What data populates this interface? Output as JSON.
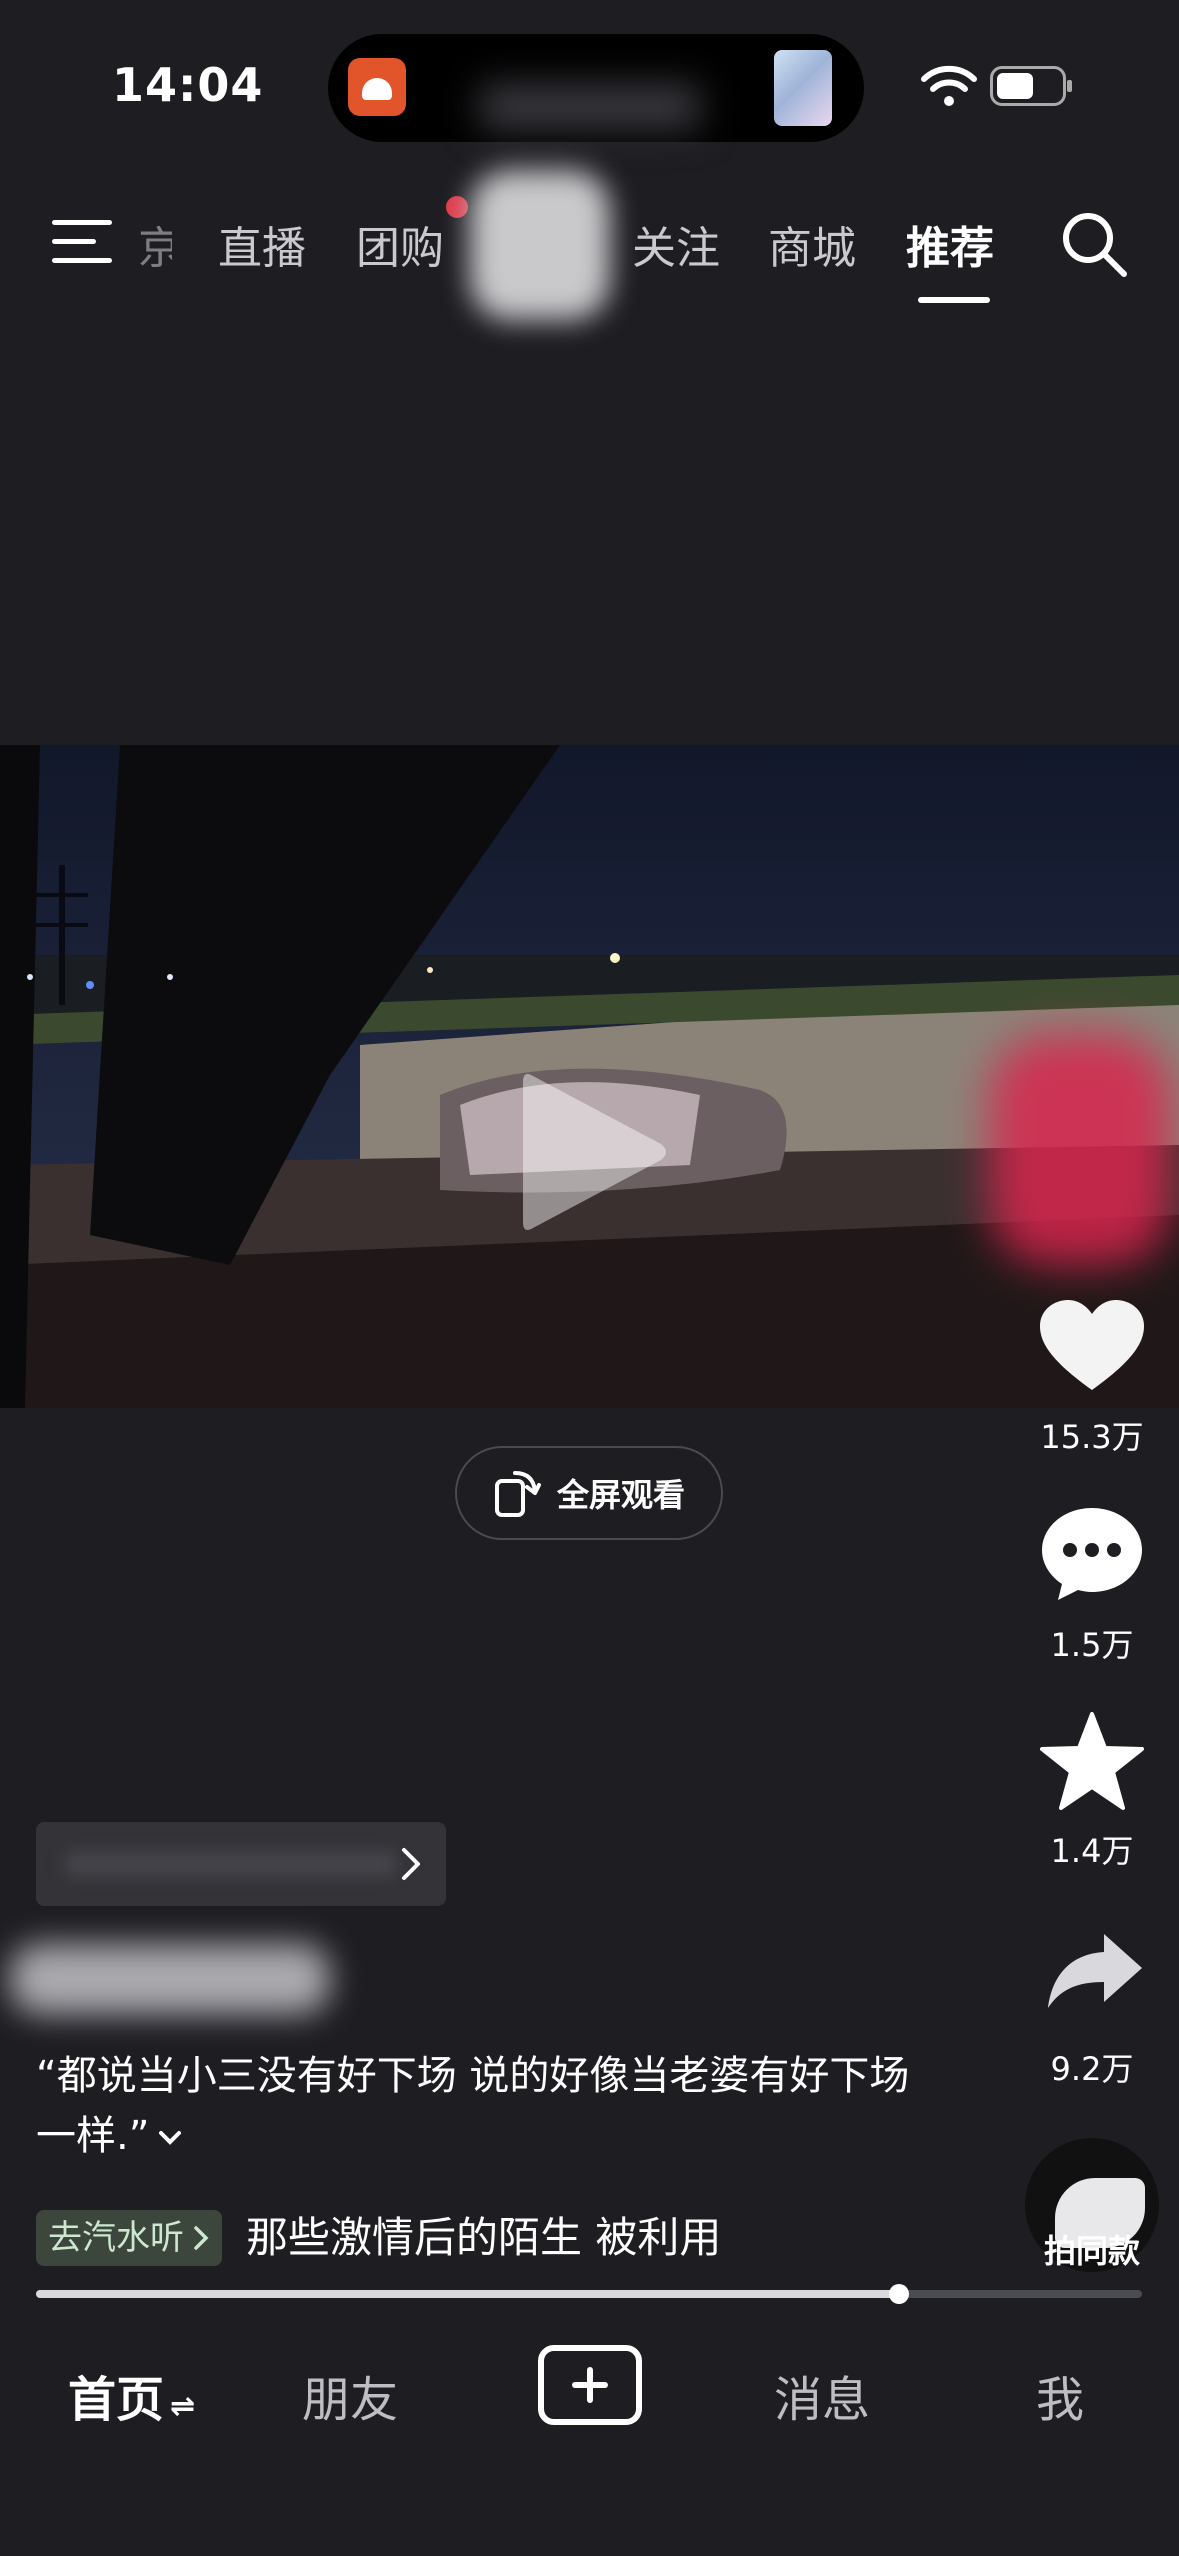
{
  "status_bar": {
    "time": "14:04"
  },
  "nav": {
    "items": [
      "京",
      "直播",
      "团购",
      "关注",
      "商城",
      "推荐"
    ],
    "active": "推荐"
  },
  "video": {
    "fullscreen_label": "全屏观看"
  },
  "actions": {
    "likes": "15.3万",
    "comments": "1.5万",
    "favorites": "1.4万",
    "shares": "9.2万",
    "remix_label": "拍同款"
  },
  "post": {
    "caption": "“都说当小三没有好下场 说的好像当老婆有好下场一样.”",
    "music_tag": "去汽水听",
    "music_text": "那些激情后的陌生 被利用",
    "progress": 0.78
  },
  "tabbar": {
    "home": "首页",
    "friends": "朋友",
    "messages": "消息",
    "me": "我"
  },
  "colors": {
    "background": "#1e1d22",
    "live_dot": "#e03a4b",
    "music_tag_bg": "#3d463d"
  }
}
